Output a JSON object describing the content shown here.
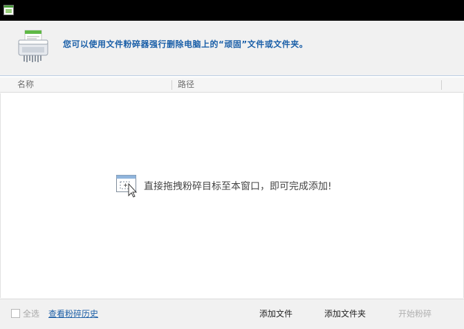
{
  "titlebar": {
    "icon": "app-window-icon"
  },
  "banner": {
    "icon": "shredder-icon",
    "text": "您可以使用文件粉碎器强行删除电脑上的“顽固”文件或文件夹。"
  },
  "columns": [
    {
      "label": "名称"
    },
    {
      "label": "路径"
    }
  ],
  "list": {
    "empty_icon": "drag-drop-icon",
    "empty_text": "直接拖拽粉碎目标至本窗口，即可完成添加!"
  },
  "footer": {
    "select_all_label": "全选",
    "history_link": "查看粉碎历史",
    "add_file_label": "添加文件",
    "add_folder_label": "添加文件夹",
    "start_label": "开始粉碎"
  },
  "colors": {
    "accent": "#1a5fa8",
    "disabled": "#b0b0b0",
    "banner_bg": "#f1f1f1"
  }
}
